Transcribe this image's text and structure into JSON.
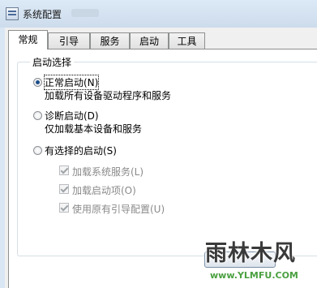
{
  "window": {
    "title": "系统配置"
  },
  "tabs": [
    {
      "label": "常规"
    },
    {
      "label": "引导"
    },
    {
      "label": "服务"
    },
    {
      "label": "启动"
    },
    {
      "label": "工具"
    }
  ],
  "startup": {
    "group_title": "启动选择",
    "options": [
      {
        "label": "正常启动(N)",
        "description": "加载所有设备驱动程序和服务",
        "selected": true
      },
      {
        "label": "诊断启动(D)",
        "description": "仅加载基本设备和服务",
        "selected": false
      },
      {
        "label": "有选择的启动(S)",
        "description": "",
        "selected": false
      }
    ],
    "selective_items": [
      {
        "label": "加载系统服务(L)",
        "checked": true,
        "enabled": false
      },
      {
        "label": "加载启动项(O)",
        "checked": true,
        "enabled": false
      },
      {
        "label": "使用原有引导配置(U)",
        "checked": true,
        "enabled": false
      }
    ]
  },
  "watermark": {
    "logo": "雨林木风",
    "url": "www.YLMFU.COM"
  }
}
